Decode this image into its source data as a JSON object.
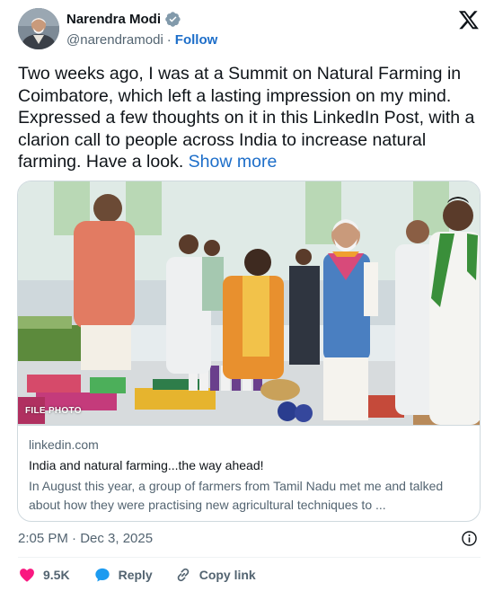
{
  "author": {
    "name": "Narendra Modi",
    "handle": "@narendramodi",
    "separator": "·",
    "follow_label": "Follow"
  },
  "tweet": {
    "text": "Two weeks ago, I was at a Summit on Natural Farming in Coimbatore, which left a lasting impression on my mind. Expressed a few thoughts on it in this LinkedIn Post, with a clarion call to people across India to increase natural farming. Have a look.",
    "show_more_label": "Show more"
  },
  "link_card": {
    "photo_tag": "FILE PHOTO",
    "domain": "linkedin.com",
    "title": "India and natural farming...the way ahead!",
    "description": "In August this year, a group of farmers from Tamil Nadu met me and talked about how they were practising new agricultural techniques to ..."
  },
  "footer": {
    "timestamp": "2:05 PM · Dec 3, 2025",
    "likes": "9.5K",
    "reply_label": "Reply",
    "copy_link_label": "Copy link"
  },
  "colors": {
    "accent": "#1d6ec9",
    "like": "#f91880",
    "verified": "#829aab",
    "muted": "#536471"
  },
  "icons": [
    "verified-badge-icon",
    "x-logo-icon",
    "info-icon",
    "heart-icon",
    "reply-bubble-icon",
    "link-icon"
  ]
}
